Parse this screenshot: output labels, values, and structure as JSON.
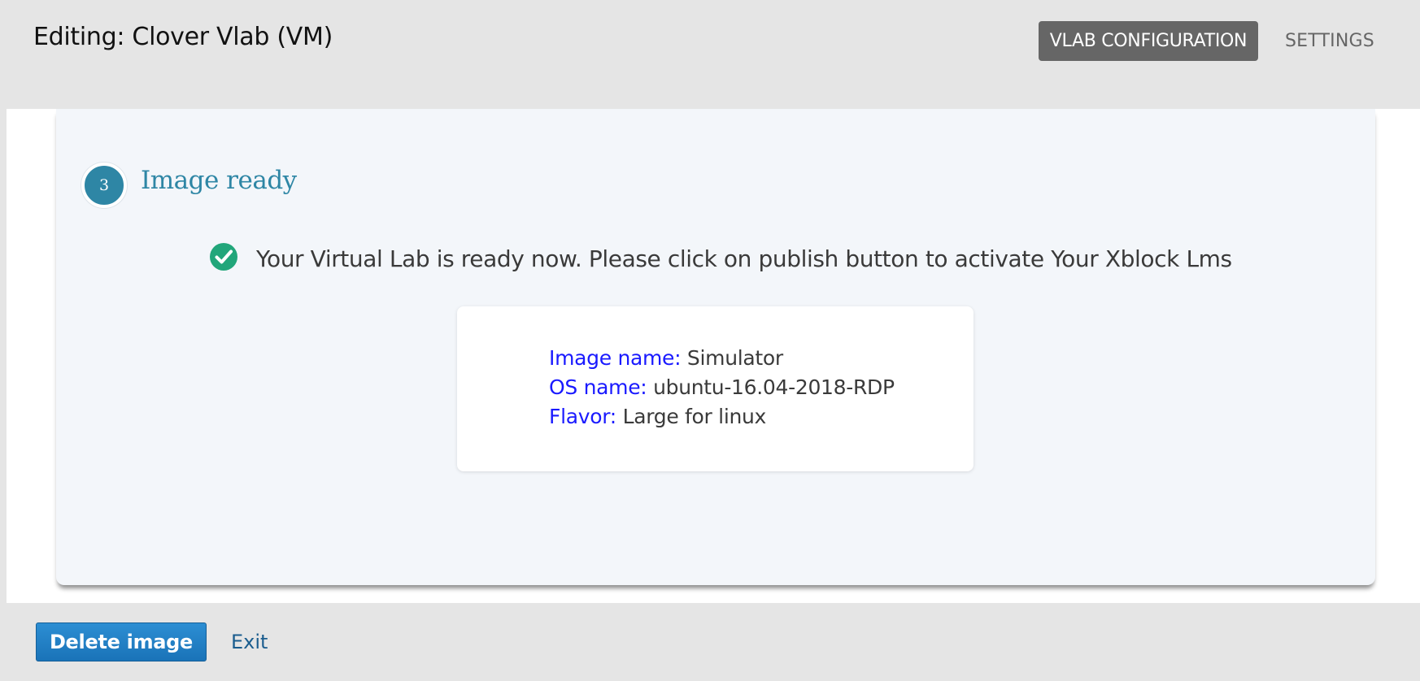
{
  "header": {
    "title": "Editing: Clover Vlab (VM)",
    "tabs": [
      {
        "label": "VLAB CONFIGURATION",
        "active": true
      },
      {
        "label": "SETTINGS",
        "active": false
      }
    ]
  },
  "step": {
    "number": "3",
    "title": "Image ready"
  },
  "status": {
    "icon": "check-circle-icon",
    "message": "Your Virtual Lab is ready now. Please click on publish button to activate Your Xblock Lms"
  },
  "image_info": {
    "image_name_label": "Image name:",
    "image_name_value": "Simulator",
    "os_name_label": "OS name:",
    "os_name_value": "ubuntu-16.04-2018-RDP",
    "flavor_label": "Flavor:",
    "flavor_value": "Large for linux"
  },
  "footer": {
    "delete_label": "Delete image",
    "exit_label": "Exit"
  },
  "colors": {
    "accent": "#2e86a5",
    "success": "#21a67a",
    "key_text": "#1a1aff",
    "primary_button": "#1f7dc4",
    "tab_active_bg": "#666666"
  }
}
